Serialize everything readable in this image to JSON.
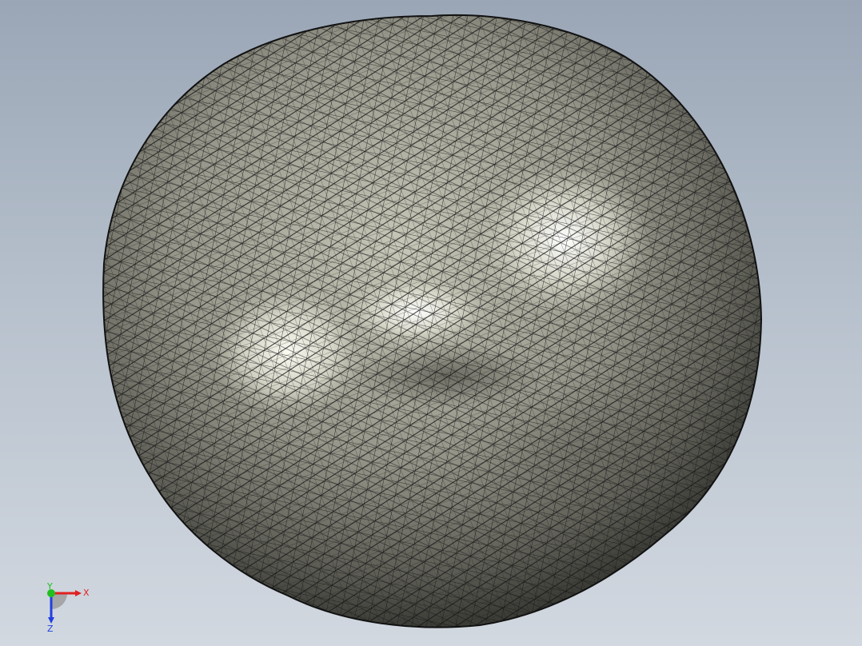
{
  "viewport": {
    "background_top": "#9aa6b6",
    "background_bottom": "#d2d8e0"
  },
  "model": {
    "name": "meshed-organic-body",
    "render_mode": "shaded-with-edges",
    "shade_color": "#8d8d80",
    "highlight_color": "#f4f4ea",
    "edge_color": "#141414"
  },
  "triad": {
    "x_label": "X",
    "y_label": "Y",
    "z_label": "Z",
    "x_color": "#e02020",
    "y_color": "#20c020",
    "z_color": "#2040e0"
  }
}
